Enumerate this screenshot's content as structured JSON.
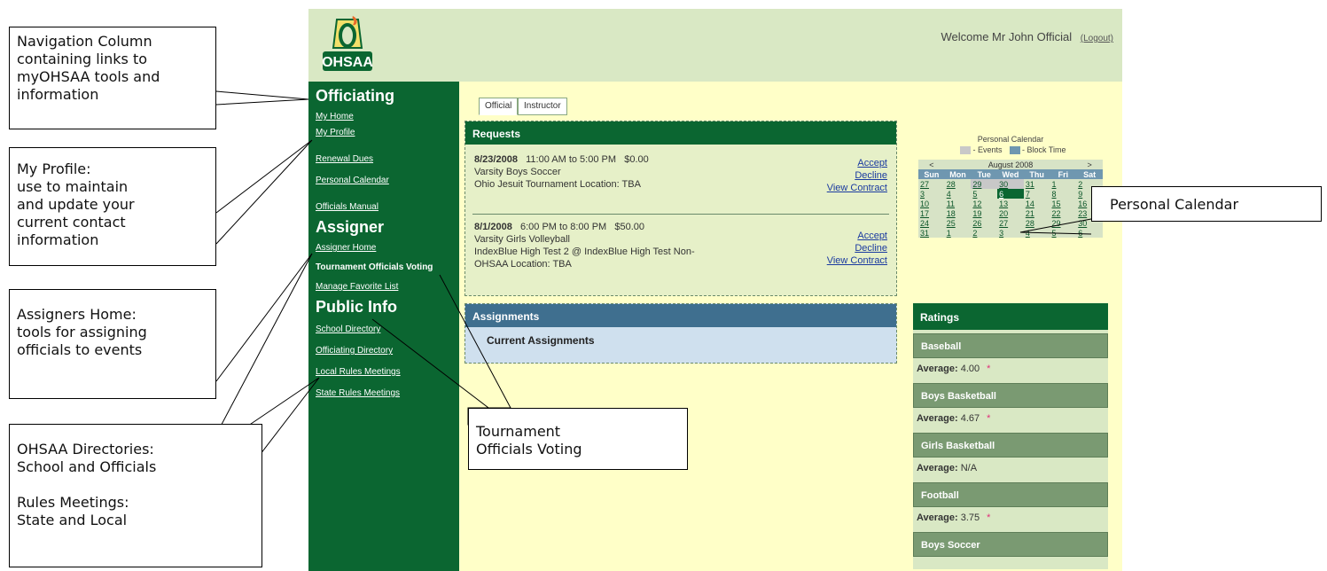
{
  "header": {
    "welcome": "Welcome Mr John Official",
    "logout": "(Logout)",
    "logo_text": "OHSAA"
  },
  "sidebar": {
    "officiating_title": "Officiating",
    "officiating_links": [
      "My Home",
      "My Profile",
      "Renewal Dues",
      "Personal Calendar",
      "Officials Manual"
    ],
    "assigner_title": "Assigner",
    "assigner_links": [
      "Assigner Home",
      "Tournament Officials Voting",
      "Manage Favorite List"
    ],
    "public_title": "Public Info",
    "public_links": [
      "School Directory",
      "Officiating Directory",
      "Local Rules Meetings",
      "State Rules Meetings"
    ]
  },
  "tabs": [
    "Official",
    "Instructor"
  ],
  "requests": {
    "title": "Requests",
    "items": [
      {
        "date": "8/23/2008",
        "time": "11:00 AM to 5:00 PM",
        "fee": "$0.00",
        "line2": "Varsity  Boys  Soccer",
        "line3": "Ohio Jesuit Tournament Location: TBA",
        "line4": ""
      },
      {
        "date": "8/1/2008",
        "time": "6:00 PM to 8:00 PM",
        "fee": "$50.00",
        "line2": "Varsity  Girls  Volleyball",
        "line3": "IndexBlue High Test 2 @ IndexBlue High Test Non-",
        "line4": "OHSAA Location: TBA"
      }
    ],
    "actions": {
      "accept": "Accept",
      "decline": "Decline",
      "contract": "View Contract"
    }
  },
  "assignments": {
    "title": "Assignments",
    "row": "Current Assignments"
  },
  "calendar": {
    "title": "Personal Calendar",
    "legend_events": "- Events",
    "legend_block": "- Block Time",
    "month": "August 2008",
    "prev": "<",
    "next": ">",
    "days": [
      "Sun",
      "Mon",
      "Tue",
      "Wed",
      "Thu",
      "Fri",
      "Sat"
    ],
    "weeks": [
      [
        "27",
        "28",
        "29",
        "30",
        "31",
        "1",
        "2"
      ],
      [
        "3",
        "4",
        "5",
        "6",
        "7",
        "8",
        "9"
      ],
      [
        "10",
        "11",
        "12",
        "13",
        "14",
        "15",
        "16"
      ],
      [
        "17",
        "18",
        "19",
        "20",
        "21",
        "22",
        "23"
      ],
      [
        "24",
        "25",
        "26",
        "27",
        "28",
        "29",
        "30"
      ],
      [
        "31",
        "1",
        "2",
        "3",
        "4",
        "5",
        "6"
      ]
    ],
    "colors": {
      "events": "#c8c8c8",
      "block": "#6f97b0",
      "today": "#0b6631"
    }
  },
  "ratings": {
    "title": "Ratings",
    "sports": [
      {
        "name": "Baseball",
        "avg_label": "Average:",
        "avg": "4.00",
        "star": "*"
      },
      {
        "name": "Boys Basketball",
        "avg_label": "Average:",
        "avg": "4.67",
        "star": "*"
      },
      {
        "name": "Girls Basketball",
        "avg_label": "Average:",
        "avg": "N/A",
        "star": ""
      },
      {
        "name": "Football",
        "avg_label": "Average:",
        "avg": "3.75",
        "star": "*"
      },
      {
        "name": "Boys Soccer",
        "avg_label": "",
        "avg": "",
        "star": ""
      }
    ]
  },
  "callouts": {
    "nav": [
      "Navigation Column",
      "containing links to",
      "myOHSAA tools and",
      "information"
    ],
    "profile": [
      "My Profile:",
      "use to maintain",
      "and update your",
      "current contact",
      "information"
    ],
    "assigners": [
      "Assigners Home:",
      "tools for assigning",
      "officials to events"
    ],
    "directories": [
      "OHSAA Directories:",
      "School and Officials",
      "",
      "Rules Meetings:",
      "State and Local"
    ],
    "voting": [
      "Tournament",
      "Officials Voting"
    ],
    "calendar": [
      "Personal Calendar"
    ]
  },
  "theme": {
    "green": "#0b6631",
    "header_bg": "#d9e8c4",
    "content_bg": "#ffffc8"
  }
}
